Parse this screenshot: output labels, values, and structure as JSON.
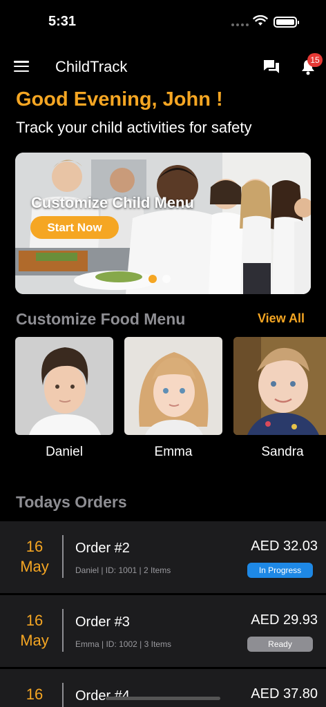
{
  "status_bar": {
    "time": "5:31"
  },
  "header": {
    "title": "ChildTrack",
    "notification_count": "15"
  },
  "greeting": {
    "title": "Good Evening, John !",
    "subtitle": "Track your child activities for safety"
  },
  "banner": {
    "title": "Customize Child Menu",
    "button_label": "Start Now"
  },
  "food_menu": {
    "title": "Customize Food Menu",
    "view_all_label": "View All",
    "children": [
      {
        "name": "Daniel"
      },
      {
        "name": "Emma"
      },
      {
        "name": "Sandra"
      }
    ]
  },
  "orders": {
    "title": "Todays Orders",
    "items": [
      {
        "day": "16",
        "month": "May",
        "name": "Order #2",
        "meta": "Daniel | ID: 1001 | 2 Items",
        "amount": "AED 32.03",
        "status": "In Progress",
        "status_color": "#1e88e5"
      },
      {
        "day": "16",
        "month": "May",
        "name": "Order #3",
        "meta": "Emma | ID: 1002 | 3 Items",
        "amount": "AED 29.93",
        "status": "Ready",
        "status_color": "#8e8e93"
      },
      {
        "day": "16",
        "month": "",
        "name": "Order #4",
        "meta": "",
        "amount": "AED 37.80",
        "status": "",
        "status_color": ""
      }
    ]
  },
  "colors": {
    "accent": "#f5a623",
    "background": "#000000",
    "card": "#1c1c1e",
    "muted": "#8e8e93"
  }
}
